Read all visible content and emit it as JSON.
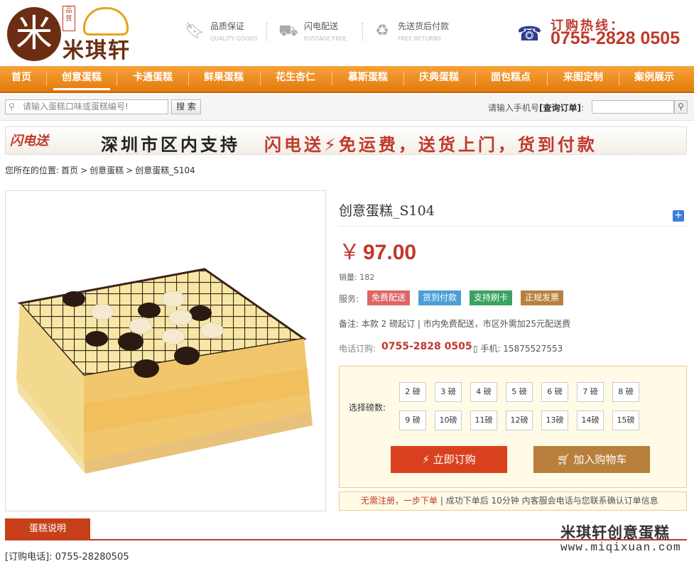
{
  "brand": {
    "logo_char": "米",
    "name": "米琪轩",
    "seal": "品質"
  },
  "features": [
    {
      "icon": "bookmark-icon",
      "title": "品质保证",
      "sub": "QUALITY GOODS"
    },
    {
      "icon": "truck-icon",
      "title": "闪电配送",
      "sub": "POSTAGE FREE"
    },
    {
      "icon": "recycle-icon",
      "title": "先送货后付款",
      "sub": "FREE RETURNS"
    }
  ],
  "hotline": {
    "label": "订购热线：",
    "number": "0755-2828 0505"
  },
  "nav": [
    {
      "label": "首页"
    },
    {
      "label": "创意蛋糕",
      "active": true
    },
    {
      "label": "卡通蛋糕"
    },
    {
      "label": "鲜果蛋糕"
    },
    {
      "label": "花生杏仁"
    },
    {
      "label": "慕斯蛋糕"
    },
    {
      "label": "庆典蛋糕"
    },
    {
      "label": "面包糕点"
    },
    {
      "label": "来图定制"
    },
    {
      "label": "案例展示"
    }
  ],
  "search": {
    "placeholder": "请输入蛋糕口味或蛋糕编号!",
    "button": "搜 索"
  },
  "order_query": {
    "label_prefix": "请输入手机号",
    "label_bold": "[查询订单]",
    "label_suffix": ":"
  },
  "banner": {
    "badge": "闪电送",
    "text1": "深圳市区内支持",
    "text2": "闪电送⚡免运费，送货上门，货到付款"
  },
  "breadcrumb": [
    "您所在的位置:",
    "首页",
    ">",
    "创意蛋糕",
    ">",
    "创意蛋糕_S104"
  ],
  "product": {
    "title": "创意蛋糕_S104",
    "currency": "￥",
    "price": "97.00",
    "sales": "销量: 182",
    "service_label": "服务:",
    "services": [
      {
        "label": "免费配送",
        "color": "#e06666"
      },
      {
        "label": "货到付款",
        "color": "#4a9fd8"
      },
      {
        "label": "支持刷卡",
        "color": "#3aa361"
      },
      {
        "label": "正规发票",
        "color": "#b8803c"
      }
    ],
    "note": "备注: 本款 2 磅起订 | 市内免费配送，市区外需加25元配送费",
    "tel_label": "电话订购:",
    "tel": "0755-2828 0505",
    "mobile": "手机: 15875527553"
  },
  "selector": {
    "label": "选择磅数:",
    "sizes": [
      "2 磅",
      "3 磅",
      "4 磅",
      "5 磅",
      "6 磅",
      "7 磅",
      "8 磅",
      "9 磅",
      "10磅",
      "11磅",
      "12磅",
      "13磅",
      "14磅",
      "15磅"
    ],
    "order_btn": "立即订购",
    "cart_btn": "加入购物车",
    "tip_red": "无需注册，一步下单",
    "tip": "|  成功下单后 10分钟 内客服会电话与您联系确认订单信息"
  },
  "tab": {
    "label": "蛋糕说明"
  },
  "watermark": {
    "line1": "米琪轩创意蛋糕",
    "line2": "www.miqixuan.com"
  },
  "order_phone": "[订购电话]: 0755-28280505"
}
